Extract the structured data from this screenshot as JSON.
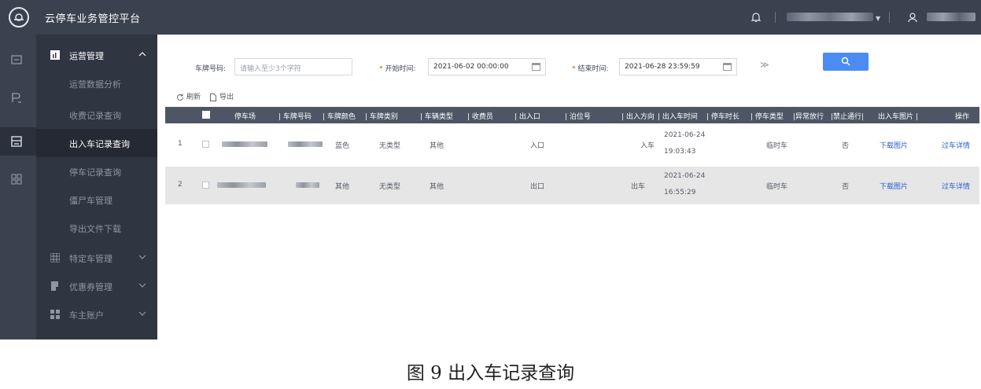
{
  "app": {
    "title": "云停车业务管控平台"
  },
  "sidebar": {
    "group_ops": "运营管理",
    "sub_items": [
      "运营数据分析",
      "收费记录查询",
      "出入车记录查询",
      "停车记录查询",
      "僵尸车管理",
      "导出文件下载"
    ],
    "group_special": "特定车管理",
    "group_coupon": "优惠券管理",
    "group_owner": "车主账户"
  },
  "filters": {
    "plate_label": "车牌号码:",
    "plate_placeholder": "请输入至少3个字符",
    "start_label": "开始时间:",
    "start_value": "2021-06-02 00:00:00",
    "end_label": "结束时间:",
    "end_value": "2021-06-28 23:59:59"
  },
  "toolbar": {
    "refresh": "刷新",
    "export": "导出"
  },
  "table": {
    "columns": [
      "停车场",
      "车牌号码",
      "车牌颜色",
      "车牌类别",
      "车辆类型",
      "收费员",
      "出入口",
      "泊位号",
      "出入方向",
      "出入车时间",
      "停车时长",
      "停车类型",
      "异常放行",
      "禁止通行",
      "出入车图片",
      "操作"
    ],
    "rows": [
      {
        "index": "1",
        "color": "蓝色",
        "plate_class": "无类型",
        "vehicle_type": "其他",
        "gate": "入口",
        "direction": "入车",
        "date": "2021-06-24",
        "time": "19:03:43",
        "parking_type": "临时车",
        "forbidden": "否",
        "image_link": "下载图片",
        "action": "过车详情"
      },
      {
        "index": "2",
        "color": "其他",
        "plate_class": "无类型",
        "vehicle_type": "其他",
        "gate": "出口",
        "direction": "出车",
        "date": "2021-06-24",
        "time": "16:55:29",
        "parking_type": "临时车",
        "forbidden": "否",
        "image_link": "下载图片",
        "action": "过车详情"
      }
    ]
  },
  "caption": "图 9 出入车记录查询",
  "colors": {
    "topbar": "#3a414f",
    "sidebar": "#2f3541",
    "accent": "#4b8cf2",
    "header": "#4e5564"
  },
  "icons": [
    "logo-icon",
    "bell-icon",
    "user-icon",
    "search-icon",
    "refresh-icon",
    "export-icon",
    "calendar-icon",
    "chevron-up-icon",
    "chevron-down-icon"
  ]
}
